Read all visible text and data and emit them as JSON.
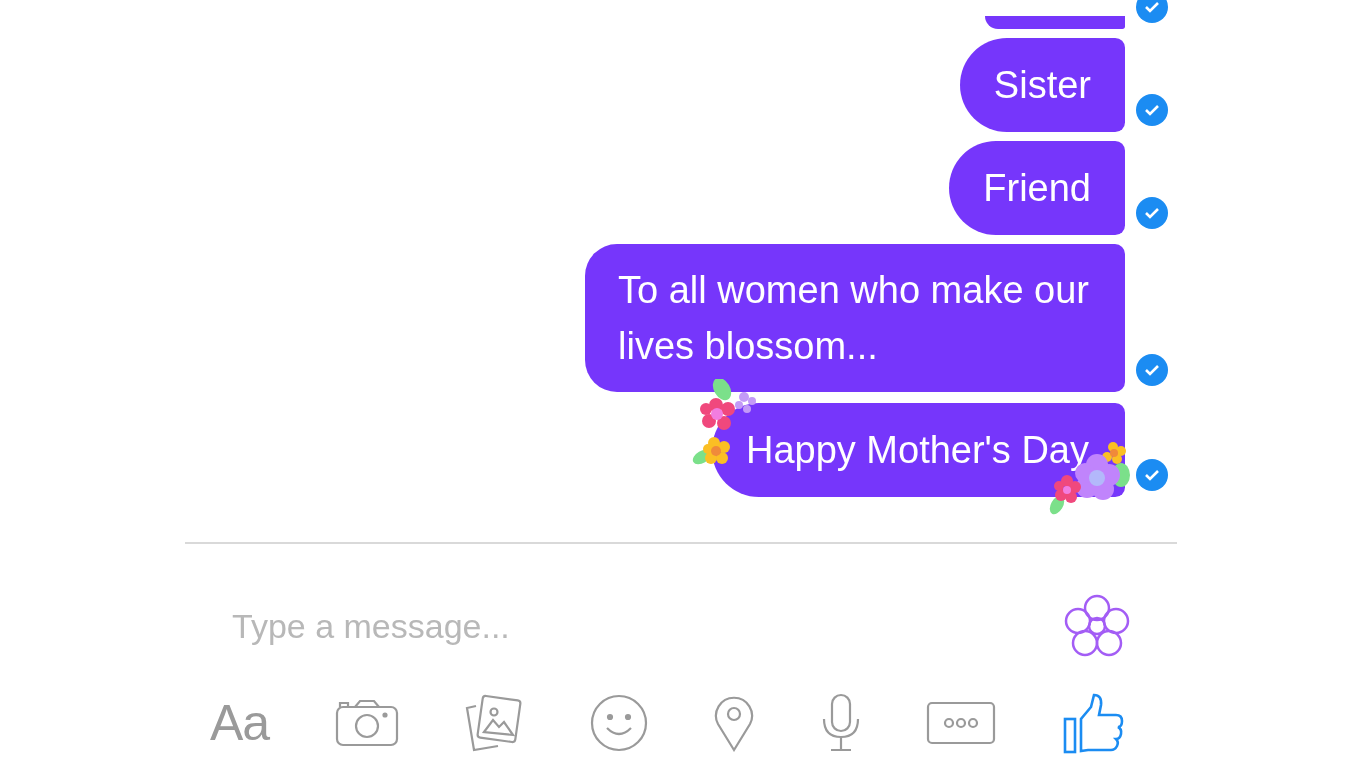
{
  "messages": [
    {
      "kind": "cut",
      "seen": true
    },
    {
      "kind": "plain",
      "text": "Sister",
      "seen": true
    },
    {
      "kind": "plain",
      "text": "Friend",
      "seen": true
    },
    {
      "kind": "plain",
      "text": "To all women who make our lives blossom...",
      "seen": true
    },
    {
      "kind": "decorated",
      "text": "Happy Mother's Day",
      "seen": true
    }
  ],
  "composer": {
    "placeholder": "Type a message..."
  },
  "toolbar": [
    {
      "kind": "text",
      "label": "Aa"
    },
    {
      "kind": "camera"
    },
    {
      "kind": "gallery"
    },
    {
      "kind": "emoji"
    },
    {
      "kind": "location"
    },
    {
      "kind": "mic"
    },
    {
      "kind": "more"
    },
    {
      "kind": "like"
    }
  ]
}
